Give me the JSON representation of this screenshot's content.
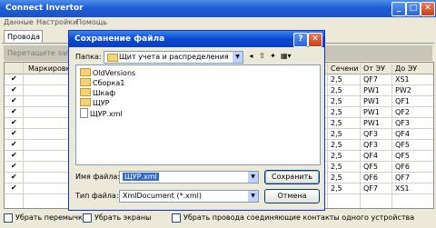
{
  "window": {
    "title": "Connect Invertor",
    "controls": [
      "_",
      "□",
      "✕"
    ]
  },
  "menu": [
    "Данные",
    "Настройки",
    "Помощь"
  ],
  "tab": "Провода",
  "group_hint": "Перетащите загол",
  "grid": {
    "headers": {
      "mark": "Маркировка",
      "section": "Сечени",
      "from": "От ЭУ",
      "to": "До ЭУ"
    },
    "rows": [
      {
        "section": "2,5",
        "from": "QF7",
        "to": "XS1"
      },
      {
        "section": "2,5",
        "from": "PW1",
        "to": "PW2"
      },
      {
        "section": "2,5",
        "from": "PW1",
        "to": "QF1"
      },
      {
        "section": "2,5",
        "from": "PW1",
        "to": "QF2"
      },
      {
        "section": "2,5",
        "from": "PW1",
        "to": "QF3"
      },
      {
        "section": "2,5",
        "from": "QF3",
        "to": "QF4"
      },
      {
        "section": "2,5",
        "from": "QF3",
        "to": "QF5"
      },
      {
        "section": "2,5",
        "from": "QF4",
        "to": "QF5"
      },
      {
        "section": "2,5",
        "from": "QF5",
        "to": "QF6"
      },
      {
        "section": "2,5",
        "from": "QF6",
        "to": "QF7"
      },
      {
        "section": "2,5",
        "from": "QF7",
        "to": "XS1"
      }
    ]
  },
  "bottom": {
    "opt1": "Убрать перемычки",
    "opt2": "Убрать экраны",
    "opt3": "Убрать провода соединяющие контакты одного устройства"
  },
  "dialog": {
    "title": "Сохранение файла",
    "title_buttons": [
      "?",
      "✕"
    ],
    "folder_label": "Папка:",
    "folder_value": "Щит учета и распределения, 3D-мо",
    "files": [
      {
        "name": "OldVersions",
        "type": "folder"
      },
      {
        "name": "Сборка1",
        "type": "folder"
      },
      {
        "name": "Шкаф",
        "type": "folder"
      },
      {
        "name": "ЩУР",
        "type": "folder"
      },
      {
        "name": "ЩУР.xml",
        "type": "xml"
      }
    ],
    "filename_label": "Имя файла:",
    "filename_value": "ЩУР.xml",
    "filetype_label": "Тип файла:",
    "filetype_value": "XmlDocument (*.xml)",
    "save_label": "Сохранить",
    "cancel_label": "Отмена"
  }
}
